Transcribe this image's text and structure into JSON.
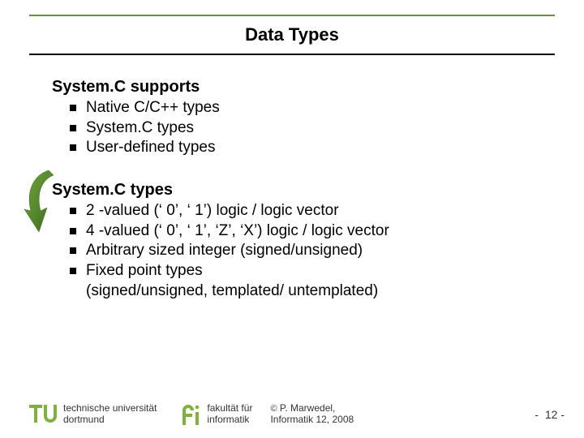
{
  "title": "Data Types",
  "sections": [
    {
      "heading": "System.C supports",
      "items": [
        "Native C/C++ types",
        "System.C types",
        "User-defined types"
      ]
    },
    {
      "heading": "System.C types",
      "items": [
        "2 -valued (‘ 0’, ‘ 1’) logic / logic vector",
        "4 -valued (‘ 0’, ‘ 1’, ‘Z’, ‘X’) logic / logic vector",
        "Arbitrary sized integer (signed/unsigned)",
        "Fixed point types\n(signed/unsigned, templated/ untemplated)"
      ]
    }
  ],
  "footer": {
    "university_line1": "technische universität",
    "university_line2": "dortmund",
    "faculty_line1": "fakultät für",
    "faculty_line2": "informatik",
    "copyright_line1": "P. Marwedel,",
    "copyright_line2": "Informatik 12,  2008",
    "page": "-  12 -"
  }
}
